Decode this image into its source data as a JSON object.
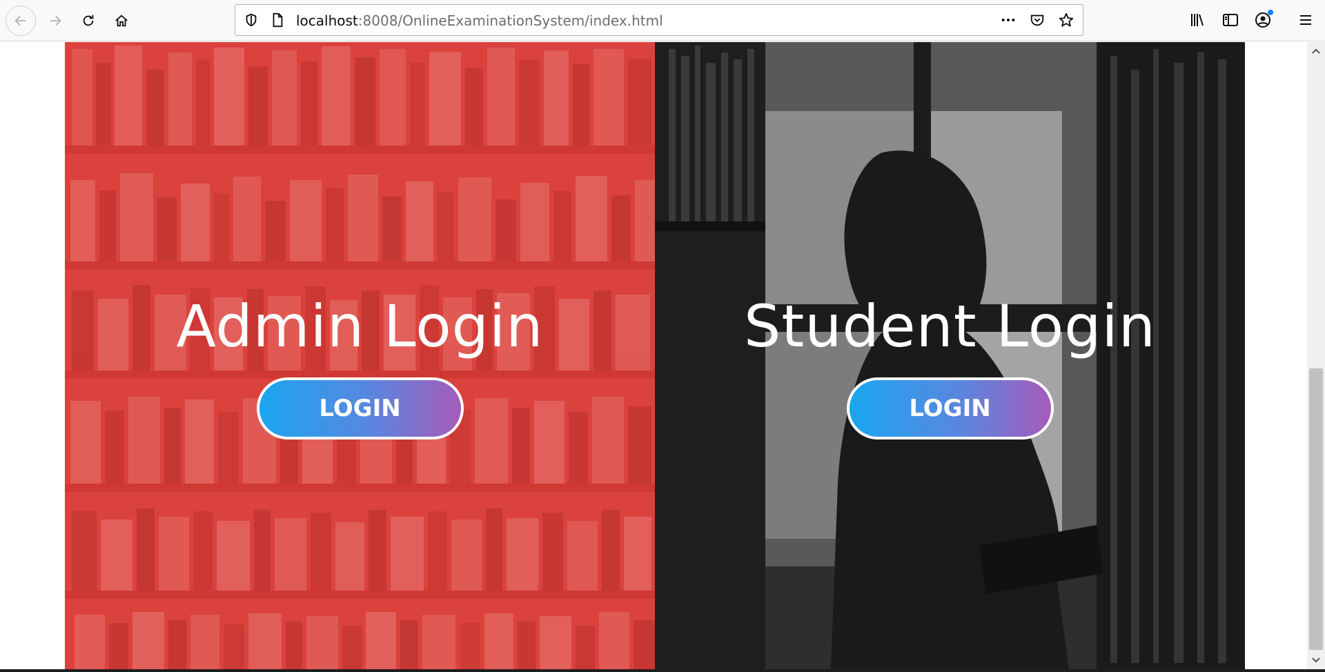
{
  "browser": {
    "url_host": "localhost",
    "url_rest": ":8008/OnlineExaminationSystem/index.html"
  },
  "icons": {
    "back": "arrow-left-icon",
    "forward": "arrow-right-icon",
    "reload": "reload-icon",
    "home": "home-icon",
    "shield": "tracking-shield-icon",
    "page": "page-icon",
    "more": "more-dots-icon",
    "pocket": "pocket-icon",
    "bookmark": "star-icon",
    "library": "library-icon",
    "sidebar": "sidebar-icon",
    "account": "account-icon",
    "menu": "hamburger-menu-icon"
  },
  "panels": {
    "admin": {
      "title": "Admin Login",
      "button_label": "LOGIN"
    },
    "student": {
      "title": "Student Login",
      "button_label": "LOGIN"
    }
  },
  "colors": {
    "admin_overlay": "#d8423e",
    "student_bg": "#2c2c2e",
    "button_gradient_start": "#1aa6f0",
    "button_gradient_end": "#a65bb8"
  }
}
